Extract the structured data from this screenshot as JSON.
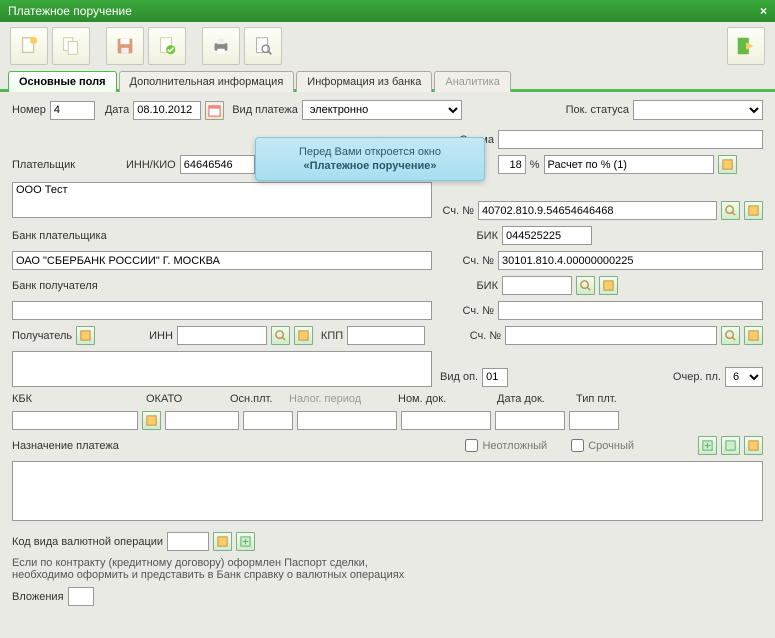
{
  "window": {
    "title": "Платежное поручение"
  },
  "tabs": {
    "t1": "Основные поля",
    "t2": "Дополнительная информация",
    "t3": "Информация из банка",
    "t4": "Аналитика"
  },
  "labels": {
    "number": "Номер",
    "date": "Дата",
    "payType": "Вид платежа",
    "status": "Пок. статуса",
    "sum": "Сумма",
    "payer": "Плательщик",
    "innkio": "ИНН/КИО",
    "percent": "%",
    "calcPercent": "Расчет по % (1)",
    "acc": "Сч. №",
    "payerBank": "Банк плательщика",
    "bik": "БИК",
    "recvBank": "Банк получателя",
    "recv": "Получатель",
    "inn": "ИНН",
    "kpp": "КПП",
    "vidop": "Вид оп.",
    "ocher": "Очер. пл.",
    "kbk": "КБК",
    "okato": "ОКАТО",
    "osn": "Осн.плт.",
    "nalog": "Налог. период",
    "nomdok": "Ном. док.",
    "datadok": "Дата док.",
    "tipplt": "Тип плт.",
    "purpose": "Назначение платежа",
    "urgent1": "Неотложный",
    "urgent2": "Срочный",
    "kodval": "Код вида валютной операции",
    "note1": "Если по контракту (кредитному договору) оформлен Паспорт сделки,",
    "note2": "необходимо оформить и представить в Банк справку о валютных операциях",
    "attach": "Вложения"
  },
  "values": {
    "number": "4",
    "date": "08.10.2012",
    "payType": "электронно",
    "innkio": "64646546",
    "percent": "18",
    "payerName": "ООО Тест",
    "payerAcc": "40702.810.9.54654646468",
    "payerBankName": "ОАО \"СБЕРБАНК РОССИИ\" Г. МОСКВА",
    "payerBik": "044525225",
    "payerBankAcc": "30101.810.4.00000000225",
    "vidop": "01",
    "ocher": "6"
  },
  "tooltip": {
    "line1": "Перед Вами откроется окно",
    "line2": "«Платежное поручение»"
  }
}
